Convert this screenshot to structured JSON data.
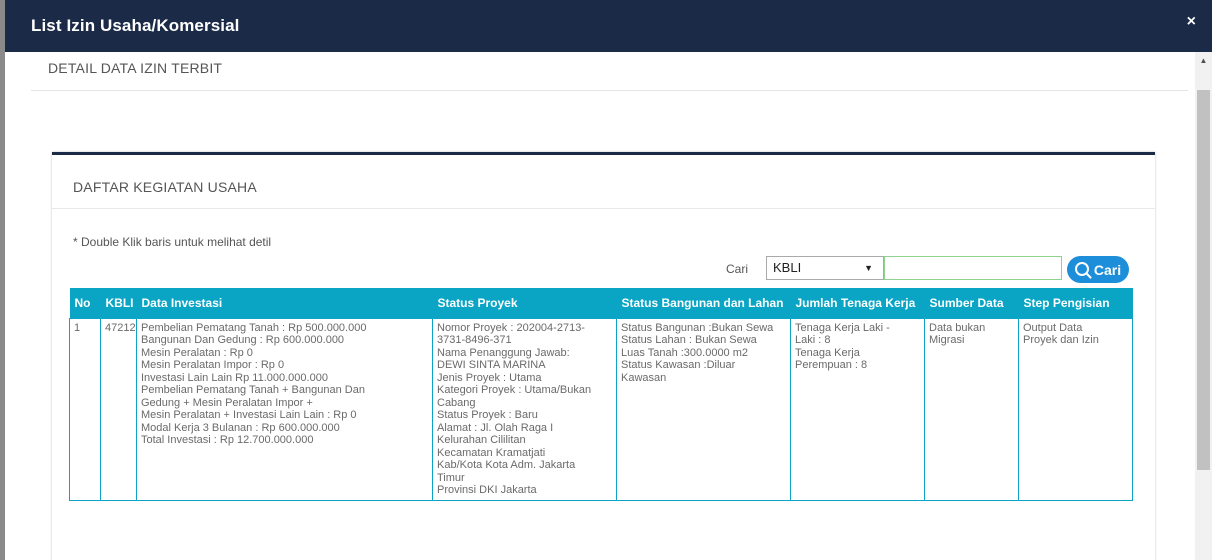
{
  "modal": {
    "title": "List Izin Usaha/Komersial",
    "close": "×"
  },
  "section": {
    "title": "DETAIL DATA IZIN TERBIT"
  },
  "panel": {
    "title": "DAFTAR KEGIATAN USAHA",
    "hint": "* Double Klik baris untuk melihat detil"
  },
  "search": {
    "label": "Cari",
    "select_value": "KBLI",
    "input_value": "",
    "button_label": "Cari"
  },
  "table": {
    "columns": [
      "No",
      "KBLI",
      "Data Investasi",
      "Status Proyek",
      "Status Bangunan dan Lahan",
      "Jumlah Tenaga Kerja",
      "Sumber Data",
      "Step Pengisian"
    ],
    "rows": [
      {
        "no": "1",
        "kbli": "47212",
        "data_investasi": [
          "Pembelian Pematang Tanah : Rp 500.000.000",
          "Bangunan Dan Gedung : Rp 600.000.000",
          "Mesin Peralatan : Rp 0",
          "Mesin Peralatan Impor : Rp 0",
          "Investasi Lain Lain Rp 11.000.000.000",
          "Pembelian Pematang Tanah + Bangunan Dan",
          "Gedung + Mesin Peralatan Impor +",
          "Mesin Peralatan + Investasi Lain Lain : Rp 0",
          "Modal Kerja 3 Bulanan : Rp 600.000.000",
          "Total Investasi : Rp 12.700.000.000"
        ],
        "status_proyek": [
          "Nomor Proyek : 202004-2713-",
          "3731-8496-371",
          "Nama Penanggung Jawab:",
          "DEWI SINTA MARINA",
          "Jenis Proyek : Utama",
          "Kategori Proyek : Utama/Bukan",
          "Cabang",
          "Status Proyek : Baru",
          "Alamat : Jl. Olah Raga I",
          "Kelurahan Cililitan",
          "Kecamatan Kramatjati",
          "Kab/Kota Kota Adm. Jakarta",
          "Timur",
          "Provinsi DKI Jakarta"
        ],
        "status_bangunan": [
          "Status Bangunan :Bukan Sewa",
          "Status Lahan : Bukan Sewa",
          "Luas Tanah :300.0000 m2",
          "Status Kawasan :Diluar",
          "Kawasan"
        ],
        "tenaga_kerja": [
          "Tenaga Kerja Laki -",
          "Laki : 8",
          "Tenaga Kerja",
          "Perempuan : 8"
        ],
        "sumber_data": [
          "Data bukan",
          "Migrasi"
        ],
        "step_pengisian": [
          "Output Data",
          "Proyek dan Izin"
        ]
      }
    ]
  },
  "colors": {
    "header_bg": "#1b2a47",
    "table_header_bg": "#0aa5c5",
    "button_bg": "#1d8ed9"
  }
}
